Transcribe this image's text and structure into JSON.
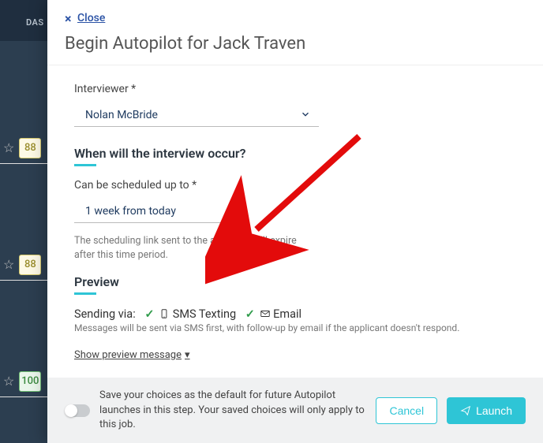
{
  "background": {
    "nav_text": "DAS",
    "rows": [
      {
        "score": "88",
        "tone": "yellow"
      },
      {
        "score": "88",
        "tone": "yellow"
      },
      {
        "score": "100",
        "tone": "green"
      }
    ]
  },
  "modal": {
    "close_label": "Close",
    "title": "Begin Autopilot for Jack Traven",
    "interviewer": {
      "label": "Interviewer *",
      "value": "Nolan McBride"
    },
    "when": {
      "heading": "When will the interview occur?",
      "label": "Can be scheduled up to *",
      "value": "1 week from today",
      "helper": "The scheduling link sent to the applicant will expire after this time period."
    },
    "preview": {
      "heading": "Preview",
      "sending_label": "Sending via:",
      "sms_label": "SMS Texting",
      "email_label": "Email",
      "note": "Messages will be sent via SMS first, with follow-up by email if the applicant doesn't respond.",
      "show_preview": "Show preview message"
    },
    "footer": {
      "save_text": "Save your choices as the default for future Autopilot launches in this step. Your saved choices will only apply to this job.",
      "cancel": "Cancel",
      "launch": "Launch"
    }
  }
}
